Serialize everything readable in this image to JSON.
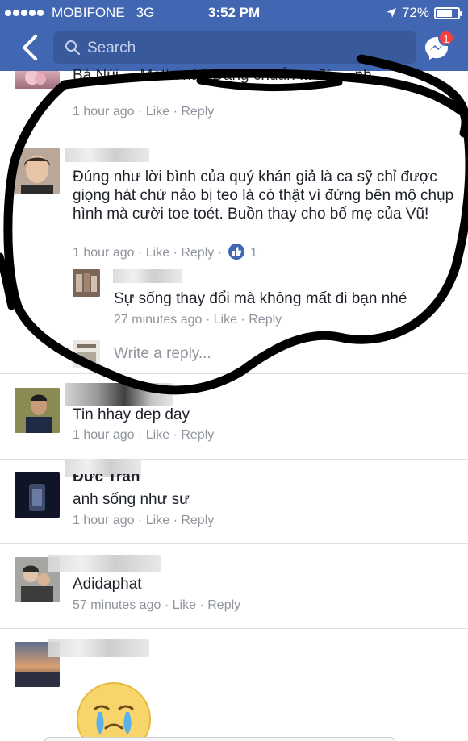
{
  "status_bar": {
    "carrier": "MOBIFONE",
    "network": "3G",
    "time": "3:52 PM",
    "battery": "72%",
    "battery_level": 0.72
  },
  "nav": {
    "search_placeholder": "Search",
    "messenger_badge": "1"
  },
  "comments": [
    {
      "text_partial": "Bà Núi ... Matta nà? Đang chuẩn ... đó ... nh",
      "time": "1 hour ago",
      "like": "Like",
      "reply": "Reply"
    },
    {
      "text": "Đúng như lời bình của quý khán giả là ca sỹ chỉ được giọng hát chứ nảo bị teo là có thật vì đứng bên mộ chụp hình mà cười toe toét. Buồn thay cho bố mẹ của Vũ!",
      "time": "1 hour ago",
      "like": "Like",
      "reply": "Reply",
      "like_count": "1",
      "replies": [
        {
          "text": "Sự sống thay đổi mà không mất đi bạn nhé",
          "time": "27 minutes ago",
          "like": "Like",
          "reply": "Reply"
        }
      ],
      "write_reply": "Write a reply..."
    },
    {
      "text": "Tin hhay dep day",
      "time": "1 hour ago",
      "like": "Like",
      "reply": "Reply"
    },
    {
      "name_partial": "Đức Trần",
      "text": "anh sống như sư",
      "time": "1 hour ago",
      "like": "Like",
      "reply": "Reply"
    },
    {
      "text": "Adidaphat",
      "time": "57 minutes ago",
      "like": "Like",
      "reply": "Reply"
    },
    {
      "emoji": "crying-face"
    }
  ],
  "separator": "·"
}
